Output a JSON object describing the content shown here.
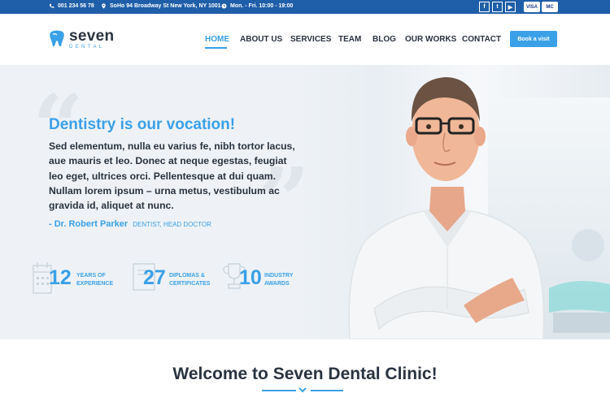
{
  "topbar": {
    "phone": "001 234 56 78",
    "address": "SoHo 94 Broadway St New York, NY 1001",
    "hours": "Mon. - Fri. 10:00 - 19:00",
    "social": [
      "f",
      "t",
      "▶"
    ],
    "cards": [
      "VISA",
      "MC"
    ]
  },
  "header": {
    "logo_word": "seven",
    "logo_sub": "DENTAL",
    "nav": [
      "HOME",
      "ABOUT US",
      "SERVICES",
      "TEAM",
      "BLOG",
      "OUR WORKS",
      "CONTACT"
    ],
    "book_label": "Book a visit"
  },
  "hero": {
    "title": "Dentistry is our vocation!",
    "text": "Sed elementum, nulla eu varius fe, nibh tortor lacus, aue mauris et leo. Donec at neque egestas, feugiat leo eget, ultrices orci. Pellentesque at dui quam. Nullam lorem ipsum – urna metus, vestibulum ac gravida id, aliquet at nunc.",
    "author_name": "- Dr. Robert Parker",
    "author_role": "DENTIST, HEAD DOCTOR",
    "stats": [
      {
        "number": "12",
        "label": "YEARS OF\nEXPERIENCE",
        "icon": "calendar-icon"
      },
      {
        "number": "27",
        "label": "DIPLOMAS &\nCERTIFICATES",
        "icon": "certificate-icon"
      },
      {
        "number": "10",
        "label": "INDUSTRY\nAWARDS",
        "icon": "trophy-icon"
      }
    ]
  },
  "welcome": {
    "title": "Welcome to Seven Dental Clinic!"
  },
  "colors": {
    "brand_blue": "#3aa0e8",
    "topbar": "#1f5ea8",
    "text_dark": "#2a3340"
  }
}
